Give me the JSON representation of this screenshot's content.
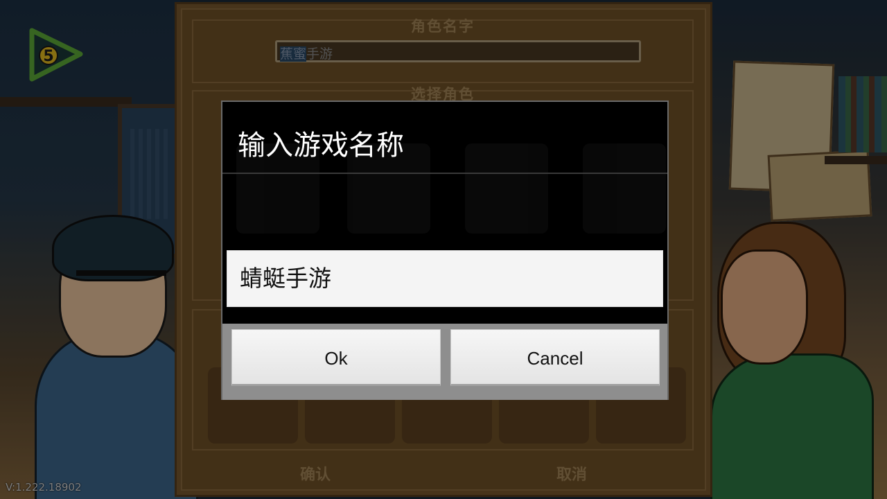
{
  "game": {
    "version": "V:1.222.18902",
    "logo_icon": "triangle-5-logo-icon",
    "logo_number": "5"
  },
  "character_panel": {
    "name_section_title": "角色名字",
    "name_field_value_selected": "蕉蜜",
    "name_field_value_rest": "手游",
    "select_section_title": "选择角色",
    "confirm_label": "确认",
    "cancel_label": "取消"
  },
  "dialog": {
    "title": "输入游戏名称",
    "input_value": "蜻蜓手游",
    "ok_label": "Ok",
    "cancel_label": "Cancel"
  },
  "colors": {
    "panel_bg": "#7a5a30",
    "dialog_bg": "#000000",
    "input_bg": "#f4f4f4",
    "button_bar": "#8e8e8e"
  }
}
